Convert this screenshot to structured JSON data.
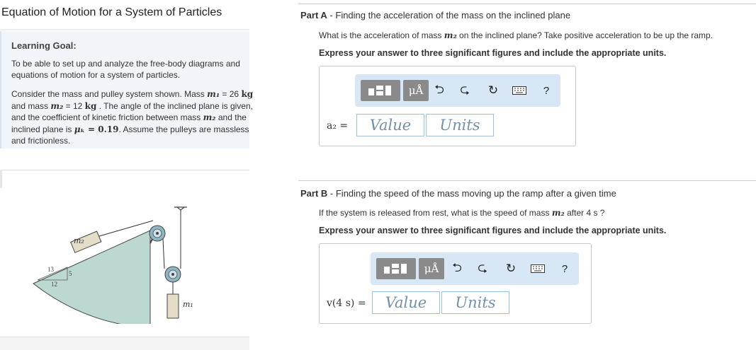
{
  "left": {
    "title": "Equation of Motion for a System of Particles",
    "goal_title": "Learning Goal:",
    "goal_text": "To be able to set up and analyze the free-body diagrams and equations of motion for a system of particles.",
    "scenario": {
      "p1": "Consider the mass and pulley system shown. Mass ",
      "m1_sym": "m₁",
      "p2": " = 26 ",
      "kg1": "kg",
      "p3": " and mass ",
      "m2_sym": "m₂",
      "p4": " = 12 ",
      "kg2": "kg",
      "p5": " . The angle of the inclined plane is given, and the coefficient of kinetic friction between mass ",
      "m2b_sym": "m₂",
      "p6": " and the inclined plane is ",
      "mu_sym": "μₖ",
      "mu_val": " = 0.19",
      "p7": ". Assume the pulleys are massless and frictionless."
    },
    "figure": {
      "m2_label": "m₂",
      "m1_label": "m₁",
      "tri_hyp": "13",
      "tri_vert": "5",
      "tri_base": "12"
    }
  },
  "part_a": {
    "label": "Part A",
    "sep": " - ",
    "heading": "Finding the acceleration of the mass on the inclined plane",
    "q_pre": "What is the acceleration of mass ",
    "q_sym": "m₂",
    "q_post": " on the inclined plane? Take positive acceleration to be up the ramp.",
    "instruction": "Express your answer to three significant figures and include the appropriate units.",
    "answer_label": "a₂ =",
    "value_placeholder": "Value",
    "units_placeholder": "Units",
    "mu_button": "μÅ",
    "help": "?"
  },
  "part_b": {
    "label": "Part B",
    "sep": " - ",
    "heading": "Finding the speed of the mass moving up the ramp after a given time",
    "q_pre": "If the system is released from rest, what is the speed of mass ",
    "q_sym": "m₂",
    "q_post": " after 4  s ?",
    "instruction": "Express your answer to three significant figures and include the appropriate units.",
    "answer_label": "v(4 s) =",
    "value_placeholder": "Value",
    "units_placeholder": "Units",
    "mu_button": "μÅ",
    "help": "?"
  },
  "icons": [
    "templates-icon",
    "units-symbol-icon",
    "undo-icon",
    "redo-icon",
    "reset-icon",
    "keyboard-icon",
    "help-icon"
  ],
  "colors": {
    "toolbar_bg": "#d7e7f6",
    "field_border": "#9cc0de",
    "goal_bg": "#f1f5fa",
    "incline_fill": "#bcd8d2"
  }
}
